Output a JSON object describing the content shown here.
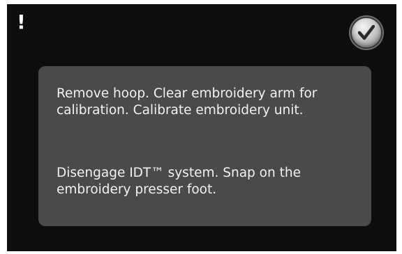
{
  "dialog": {
    "alert_symbol": "!",
    "confirm_icon": "checkmark-icon",
    "messages": [
      "Remove hoop. Clear embroidery arm for calibration. Calibrate embroidery unit.",
      "Disengage IDT™ system. Snap on the embroidery presser foot."
    ]
  },
  "colors": {
    "screen_background": "#0d0d0d",
    "panel_background": "#4a4a4a",
    "text": "#f2f2f2"
  }
}
